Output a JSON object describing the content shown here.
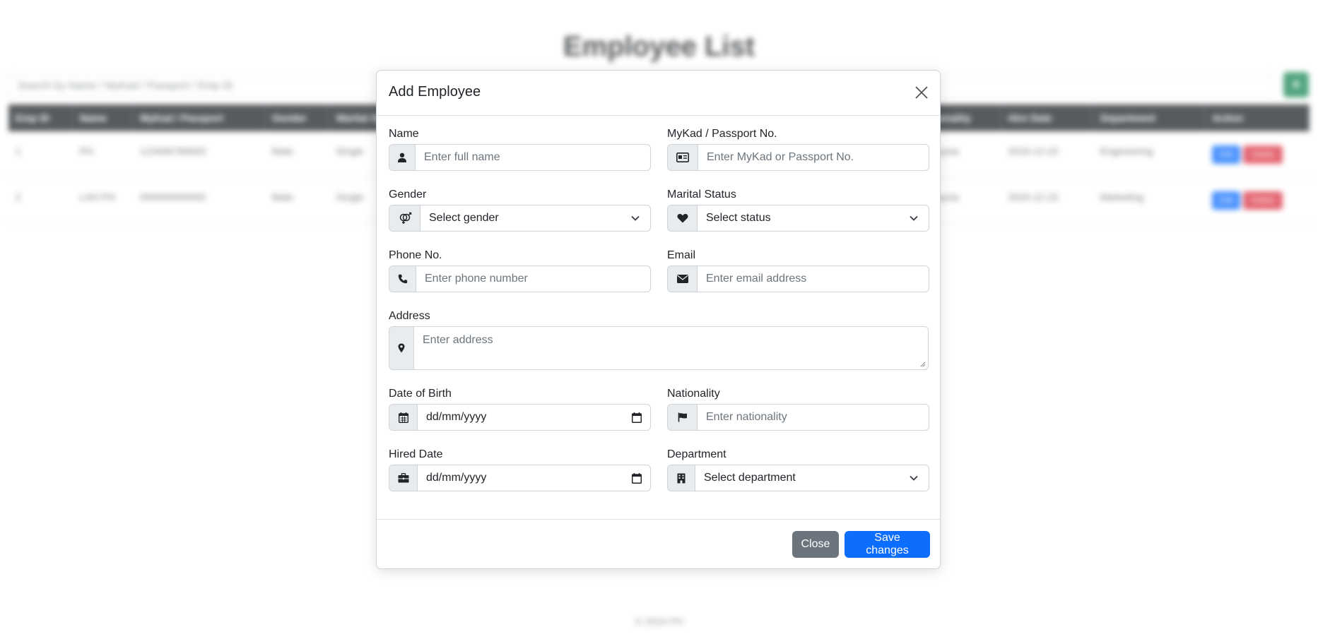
{
  "background": {
    "page_title": "Employee List",
    "search_placeholder": "Search by Name / MyKad / Passport / Emp ID",
    "add_button": "+",
    "table": {
      "headers": [
        "Emp ID",
        "Name",
        "MyKad / Passport",
        "Gender",
        "Marital Status",
        "",
        "",
        "",
        "",
        "Nationality",
        "Hire Date",
        "Department",
        "Action"
      ],
      "rows": [
        [
          "1",
          "PH",
          "123456789000",
          "Male",
          "Single",
          "",
          "",
          "",
          "",
          "Malaysia",
          "2024-12-22",
          "Engineering"
        ],
        [
          "2",
          "LAH PH",
          "000000000000",
          "Male",
          "Single",
          "",
          "",
          "",
          "",
          "Malaysia",
          "2024-12-22",
          "Marketing"
        ]
      ],
      "edit_label": "Edit",
      "delete_label": "Delete"
    },
    "footer": "© 2024 PH"
  },
  "modal": {
    "title": "Add Employee",
    "fields": {
      "name": {
        "label": "Name",
        "placeholder": "Enter full name",
        "icon": "user-icon"
      },
      "passport": {
        "label": "MyKad / Passport No.",
        "placeholder": "Enter MyKad or Passport No.",
        "icon": "id-card-icon"
      },
      "gender": {
        "label": "Gender",
        "value": "Select gender",
        "icon": "gender-icon"
      },
      "marital": {
        "label": "Marital Status",
        "value": "Select status",
        "icon": "heart-icon"
      },
      "phone": {
        "label": "Phone No.",
        "placeholder": "Enter phone number",
        "icon": "phone-icon"
      },
      "email": {
        "label": "Email",
        "placeholder": "Enter email address",
        "icon": "envelope-icon"
      },
      "address": {
        "label": "Address",
        "placeholder": "Enter address",
        "icon": "map-marker-icon"
      },
      "dob": {
        "label": "Date of Birth",
        "value": "dd/mm/yyyy",
        "icon": "calendar-icon"
      },
      "nationality": {
        "label": "Nationality",
        "placeholder": "Enter nationality",
        "icon": "flag-icon"
      },
      "hired": {
        "label": "Hired Date",
        "value": "dd/mm/yyyy",
        "icon": "briefcase-icon"
      },
      "department": {
        "label": "Department",
        "value": "Select department",
        "icon": "building-icon"
      }
    },
    "buttons": {
      "close": "Close",
      "save": "Save changes"
    }
  },
  "colors": {
    "primary": "#0d6efd",
    "secondary": "#6c757d",
    "success": "#198754",
    "danger": "#dc3545",
    "dark": "#212529"
  }
}
